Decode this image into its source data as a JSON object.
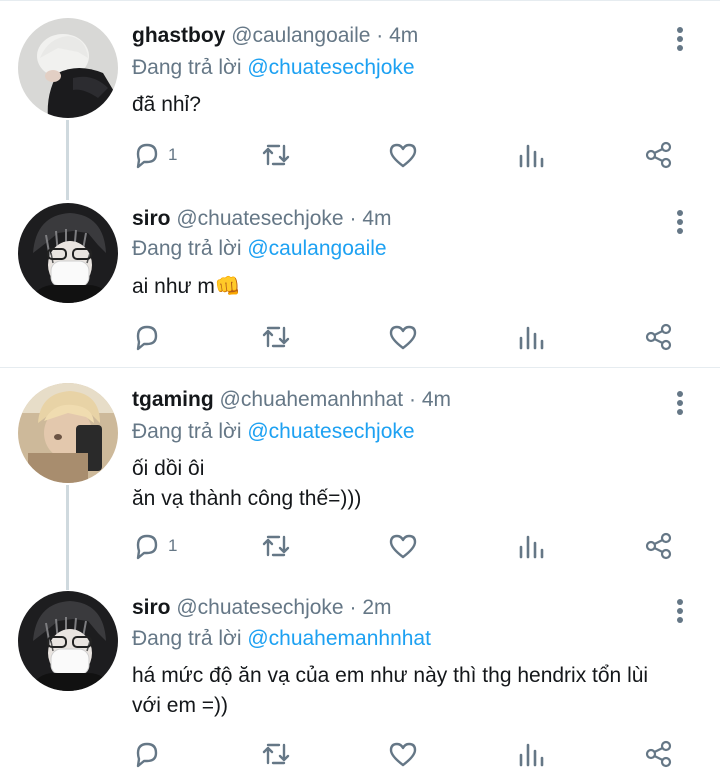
{
  "tweets": [
    {
      "name": "ghastboy",
      "handle": "@caulangoaile",
      "time": "4m",
      "reply_prefix": "Đang trả lời",
      "reply_to": "@chuatesechjoke",
      "text": "đã nhỉ?",
      "reply_count": "1"
    },
    {
      "name": "siro",
      "handle": "@chuatesechjoke",
      "time": "4m",
      "reply_prefix": "Đang trả lời",
      "reply_to": "@caulangoaile",
      "text": "ai như m👊",
      "reply_count": ""
    },
    {
      "name": "tgaming",
      "handle": "@chuahemanhnhat",
      "time": "4m",
      "reply_prefix": "Đang trả lời",
      "reply_to": "@chuatesechjoke",
      "text_line1": "ối dồi ôi",
      "text_line2": "ăn vạ thành công thế=)))",
      "reply_count": "1"
    },
    {
      "name": "siro",
      "handle": "@chuatesechjoke",
      "time": "2m",
      "reply_prefix": "Đang trả lời",
      "reply_to": "@chuahemanhnhat",
      "text_line1": "há mức độ ăn vạ của em như này thì thg hendrix tổn lùi",
      "text_line2": "với em =))",
      "reply_count": ""
    }
  ],
  "separator_dot": "·",
  "colors": {
    "accent": "#1da1f2",
    "secondary_text": "#657786",
    "primary_text": "#14171a"
  },
  "icons": [
    "reply-icon",
    "retweet-icon",
    "like-icon",
    "analytics-icon",
    "share-icon",
    "more-icon"
  ]
}
